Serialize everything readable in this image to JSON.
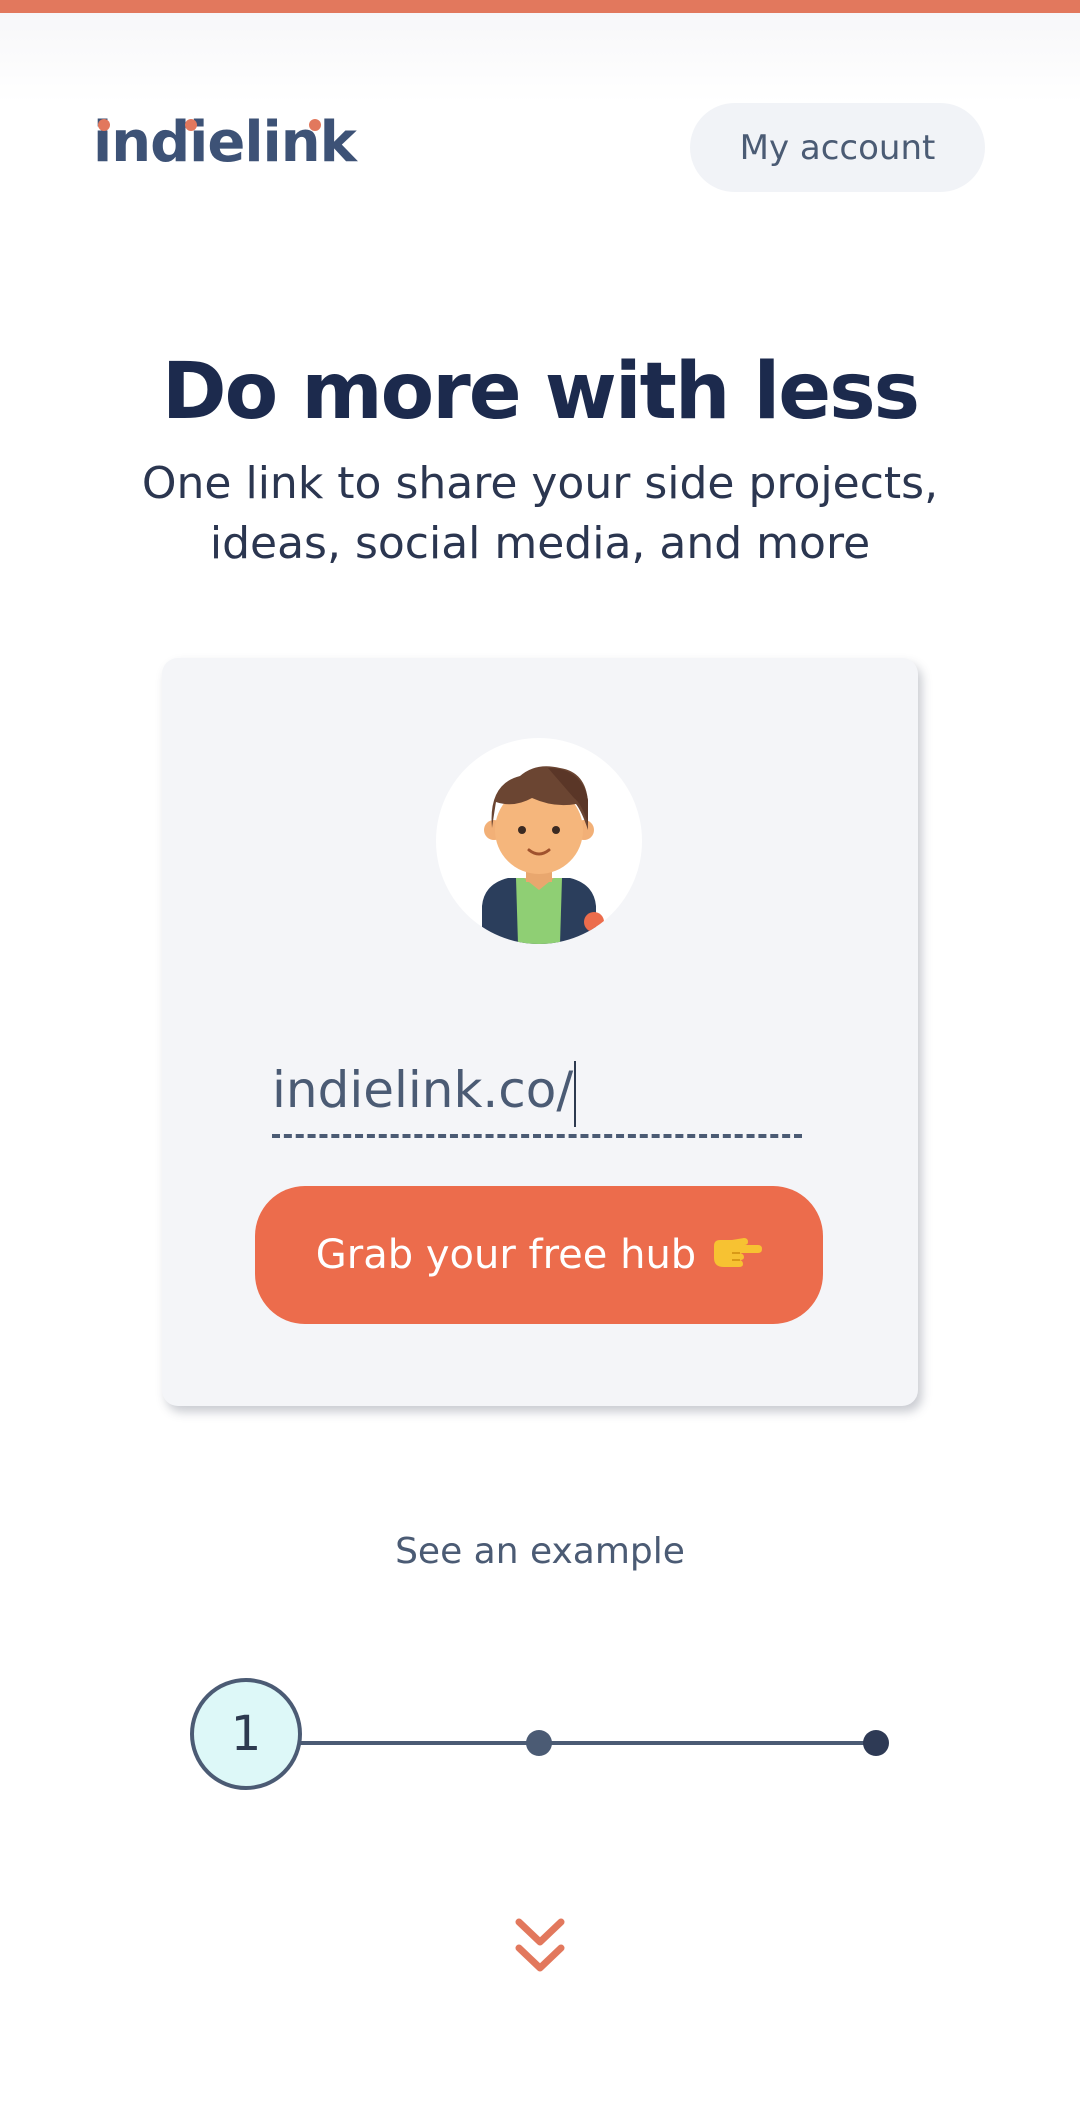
{
  "brand": {
    "logo_text": "indielink",
    "accent_color": "#e2785d",
    "text_color": "#3d5276"
  },
  "header": {
    "account_label": "My account"
  },
  "hero": {
    "title": "Do more with less",
    "subtitle": "One link to share your side projects, ideas, social media, and more"
  },
  "signup_card": {
    "avatar_icon": "avatar-person-icon",
    "url_prefix": "indielink.co/",
    "url_value": "",
    "cta_label": "Grab your free hub",
    "cta_emoji": "👉",
    "cta_color": "#ec6c4c"
  },
  "example_link": "See an example",
  "stepper": {
    "current_step_label": "1",
    "total_steps": 3,
    "current_step": 1
  },
  "scroll_indicator_icon": "double-chevron-down-icon"
}
